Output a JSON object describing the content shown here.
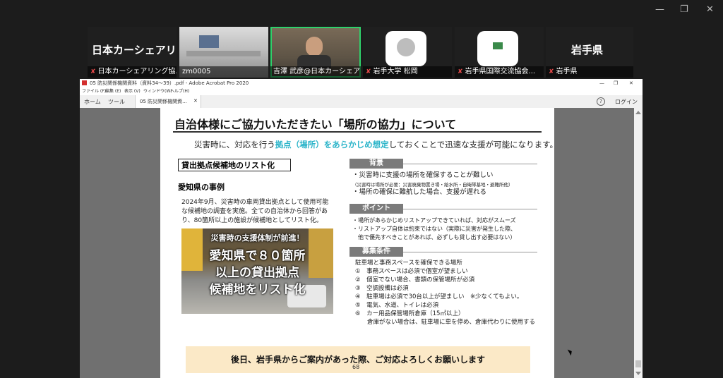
{
  "window_controls": {
    "minimize": "—",
    "restore": "❐",
    "close": "✕"
  },
  "participants": {
    "org_label": "日本カーシェアリ...",
    "tiles": [
      {
        "name": "日本カーシェアリング協..."
      },
      {
        "name": "zm0005"
      },
      {
        "name": "吉澤 武彦@日本カーシェア..."
      },
      {
        "name": "岩手大学 松岡"
      },
      {
        "name": "岩手県国際交流協会..."
      },
      {
        "name": "岩手県"
      }
    ],
    "big_label_right": "岩手県"
  },
  "acrobat": {
    "window_title": "05 防災関係機関資料（資料34〜39）.pdf - Adobe Acrobat Pro 2020",
    "menu": [
      "ファイル (F)",
      "編集 (E)",
      "表示 (V)",
      "ウィンドウ(W)",
      "ヘルプ(H)"
    ],
    "tabs": {
      "home": "ホーム",
      "tools": "ツール",
      "doc": "05 防災関係機関資..."
    },
    "help_icon": "?",
    "login": "ログイン"
  },
  "slide": {
    "title": "自治体様にご協力いただきたい「場所の協力」について",
    "sub_pre": "災害時に、対応を行う",
    "sub_hl": "拠点（場所）をあらかじめ想定",
    "sub_post": "しておくことで迅速な支援が可能になります。",
    "left_header": "貸出拠点候補地のリスト化",
    "case_title": "愛知県の事例",
    "case_body": "2024年9月、災害時の車両貸出拠点として使用可能な候補地の調査を実施。全ての自治体から回答があり、80箇所以上の施設が候補地としてリスト化。",
    "photo_lines": [
      "災害時の支援体制が前進！",
      "愛知県で８０箇所",
      "以上の貸出拠点",
      "候補地をリスト化"
    ],
    "sections": {
      "background": {
        "title": "背景",
        "items": [
          "・災害時に支援の場所を確保することが難しい",
          "（災害時は場所が必要：災害廃棄物置き場・給水所・自衛隊基地・避難所他）",
          "・場所の確保に難航した場合、支援が遅れる"
        ]
      },
      "point": {
        "title": "ポイント",
        "items": [
          "・場所があらかじめリストアップできていれば、対応がスムーズ",
          "・リストアップ自体は約束ではない（実際に災害が発生した際、",
          "　他で優先すべきことがあれば、必ずしも貸し出す必要はない）"
        ]
      },
      "conditions": {
        "title": "募集条件",
        "intro": "駐車場と事務スペースを確保できる場所",
        "items": [
          "①　事務スペースは必須で個室が望ましい",
          "②　個室でない場合、書類の保管場所が必須",
          "③　空調設備は必須",
          "④　駐車場は必須で30台以上が望ましい　※少なくてもよい。",
          "⑤　電気、水道、トイレは必須",
          "⑥　カー用品保管場所倉庫（15㎡以上）",
          "　　倉庫がない場合は、駐車場に車を停め、倉庫代わりに使用する"
        ]
      }
    },
    "banner": "後日、岩手県からご案内があった際、ご対応よろしくお願いします",
    "page_number": "68"
  }
}
